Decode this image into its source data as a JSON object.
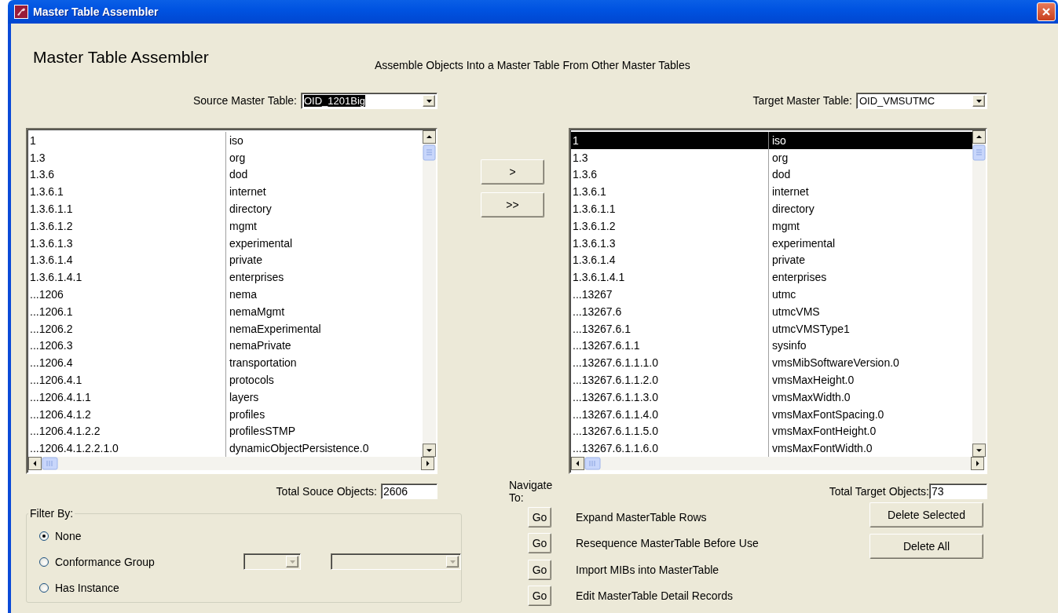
{
  "window": {
    "title": "Master Table Assembler"
  },
  "heading": "Master Table Assembler",
  "subtitle": "Assemble Objects Into a Master Table From Other Master Tables",
  "source": {
    "label": "Source Master Table:",
    "value": "OID_1201Big",
    "text_selected": true,
    "rows": [
      {
        "oid": "1",
        "name": "iso",
        "selected": false
      },
      {
        "oid": "1.3",
        "name": "org",
        "selected": false
      },
      {
        "oid": "1.3.6",
        "name": "dod",
        "selected": false
      },
      {
        "oid": "1.3.6.1",
        "name": "internet",
        "selected": false
      },
      {
        "oid": "1.3.6.1.1",
        "name": "directory",
        "selected": false
      },
      {
        "oid": "1.3.6.1.2",
        "name": "mgmt",
        "selected": false
      },
      {
        "oid": "1.3.6.1.3",
        "name": "experimental",
        "selected": false
      },
      {
        "oid": "1.3.6.1.4",
        "name": "private",
        "selected": false
      },
      {
        "oid": "1.3.6.1.4.1",
        "name": "enterprises",
        "selected": false
      },
      {
        "oid": "...1206",
        "name": "nema",
        "selected": false
      },
      {
        "oid": "...1206.1",
        "name": "nemaMgmt",
        "selected": false
      },
      {
        "oid": "...1206.2",
        "name": "nemaExperimental",
        "selected": false
      },
      {
        "oid": "...1206.3",
        "name": "nemaPrivate",
        "selected": false
      },
      {
        "oid": "...1206.4",
        "name": "transportation",
        "selected": false
      },
      {
        "oid": "...1206.4.1",
        "name": "protocols",
        "selected": false
      },
      {
        "oid": "...1206.4.1.1",
        "name": "layers",
        "selected": false
      },
      {
        "oid": "...1206.4.1.2",
        "name": "profiles",
        "selected": false
      },
      {
        "oid": "...1206.4.1.2.2",
        "name": "profilesSTMP",
        "selected": false
      },
      {
        "oid": "...1206.4.1.2.2.1.0",
        "name": "dynamicObjectPersistence.0",
        "selected": false
      }
    ],
    "total_label": "Total Souce Objects:",
    "total": "2606"
  },
  "target": {
    "label": "Target Master Table:",
    "value": "OID_VMSUTMC",
    "text_selected": false,
    "rows": [
      {
        "oid": "1",
        "name": "iso",
        "selected": true
      },
      {
        "oid": "1.3",
        "name": "org",
        "selected": false
      },
      {
        "oid": "1.3.6",
        "name": "dod",
        "selected": false
      },
      {
        "oid": "1.3.6.1",
        "name": "internet",
        "selected": false
      },
      {
        "oid": "1.3.6.1.1",
        "name": "directory",
        "selected": false
      },
      {
        "oid": "1.3.6.1.2",
        "name": "mgmt",
        "selected": false
      },
      {
        "oid": "1.3.6.1.3",
        "name": "experimental",
        "selected": false
      },
      {
        "oid": "1.3.6.1.4",
        "name": "private",
        "selected": false
      },
      {
        "oid": "1.3.6.1.4.1",
        "name": "enterprises",
        "selected": false
      },
      {
        "oid": "...13267",
        "name": "utmc",
        "selected": false
      },
      {
        "oid": "...13267.6",
        "name": "utmcVMS",
        "selected": false
      },
      {
        "oid": "...13267.6.1",
        "name": "utmcVMSType1",
        "selected": false
      },
      {
        "oid": "...13267.6.1.1",
        "name": "sysinfo",
        "selected": false
      },
      {
        "oid": "...13267.6.1.1.1.0",
        "name": "vmsMibSoftwareVersion.0",
        "selected": false
      },
      {
        "oid": "...13267.6.1.1.2.0",
        "name": "vmsMaxHeight.0",
        "selected": false
      },
      {
        "oid": "...13267.6.1.1.3.0",
        "name": "vmsMaxWidth.0",
        "selected": false
      },
      {
        "oid": "...13267.6.1.1.4.0",
        "name": "vmsMaxFontSpacing.0",
        "selected": false
      },
      {
        "oid": "...13267.6.1.1.5.0",
        "name": "vmsMaxFontHeight.0",
        "selected": false
      },
      {
        "oid": "...13267.6.1.1.6.0",
        "name": "vmsMaxFontWidth.0",
        "selected": false
      }
    ],
    "total_label": "Total Target Objects:",
    "total": "73"
  },
  "transfer_buttons": [
    ">",
    ">>"
  ],
  "filter": {
    "legend": "Filter By:",
    "options": [
      {
        "label": "None",
        "selected": true
      },
      {
        "label": "Conformance Group",
        "selected": false
      },
      {
        "label": "Has Instance",
        "selected": false
      }
    ],
    "combos": [
      {
        "disabled": true
      },
      {
        "disabled": true
      }
    ]
  },
  "navigate": {
    "label": "Navigate To:",
    "actions": [
      {
        "button": "Go",
        "label": "Expand MasterTable Rows"
      },
      {
        "button": "Go",
        "label": "Resequence MasterTable Before Use"
      },
      {
        "button": "Go",
        "label": "Import MIBs into MasterTable"
      },
      {
        "button": "Go",
        "label": "Edit MasterTable Detail Records"
      }
    ]
  },
  "delete_buttons": [
    "Delete Selected",
    "Delete All"
  ]
}
